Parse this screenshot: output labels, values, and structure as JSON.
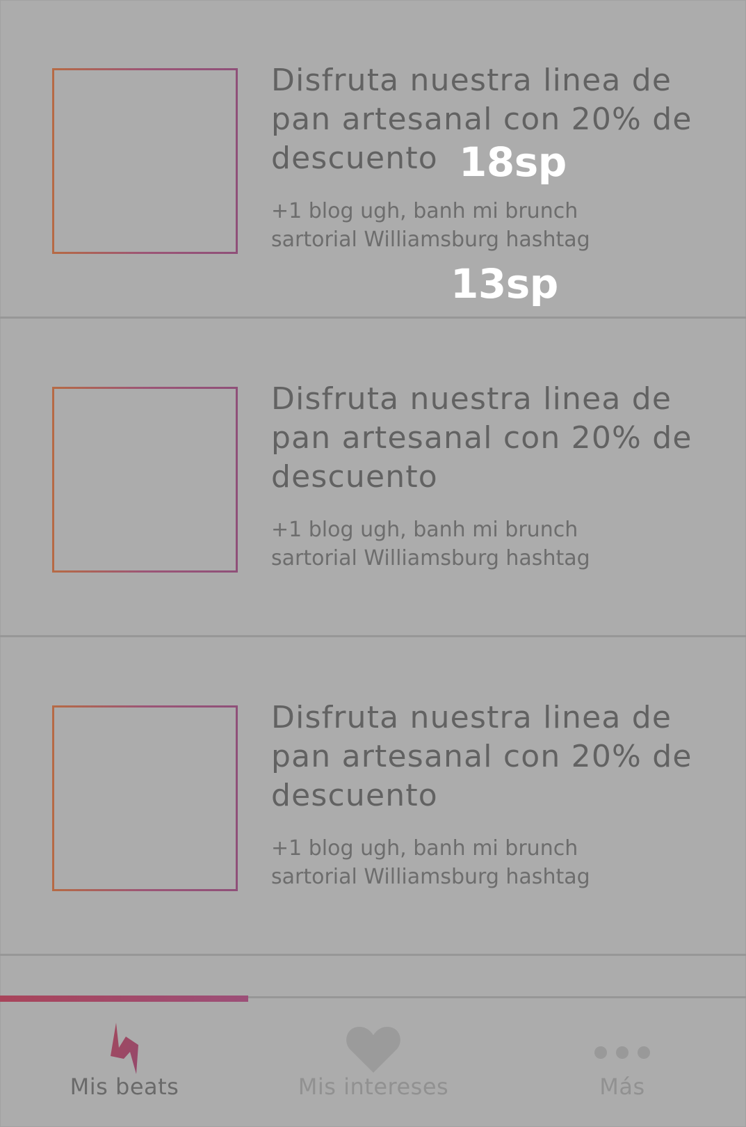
{
  "cards": [
    {
      "title": "Disfruta nuestra linea de pan artesanal con 20% de descuento",
      "description": "+1 blog ugh, banh mi brunch sartorial Williamsburg hashtag"
    },
    {
      "title": "Disfruta nuestra linea de pan artesanal con 20% de descuento",
      "description": "+1 blog ugh, banh mi brunch sartorial Williamsburg hashtag"
    },
    {
      "title": "Disfruta nuestra linea de pan artesanal con 20% de descuento",
      "description": "+1 blog ugh, banh mi brunch sartorial Williamsburg hashtag"
    }
  ],
  "annotations": {
    "title_size": "18sp",
    "description_size": "13sp"
  },
  "tabbar": {
    "tabs": [
      {
        "label": "Mis beats",
        "icon": "lightning-icon",
        "active": true
      },
      {
        "label": "Mis intereses",
        "icon": "heart-icon",
        "active": false
      },
      {
        "label": "Más",
        "icon": "more-dots-icon",
        "active": false
      }
    ],
    "active_progress": 0.333
  },
  "colors": {
    "background": "#acacac",
    "divider": "#979797",
    "title_text": "#626262",
    "description_text": "#6d6d6d",
    "accent_start": "#a8445a",
    "accent_end": "#9c4f78",
    "thumb_border_start": "#b66a45",
    "thumb_border_end": "#8f5079",
    "inactive_icon": "#9a9a9a",
    "annotation": "#ffffff"
  }
}
